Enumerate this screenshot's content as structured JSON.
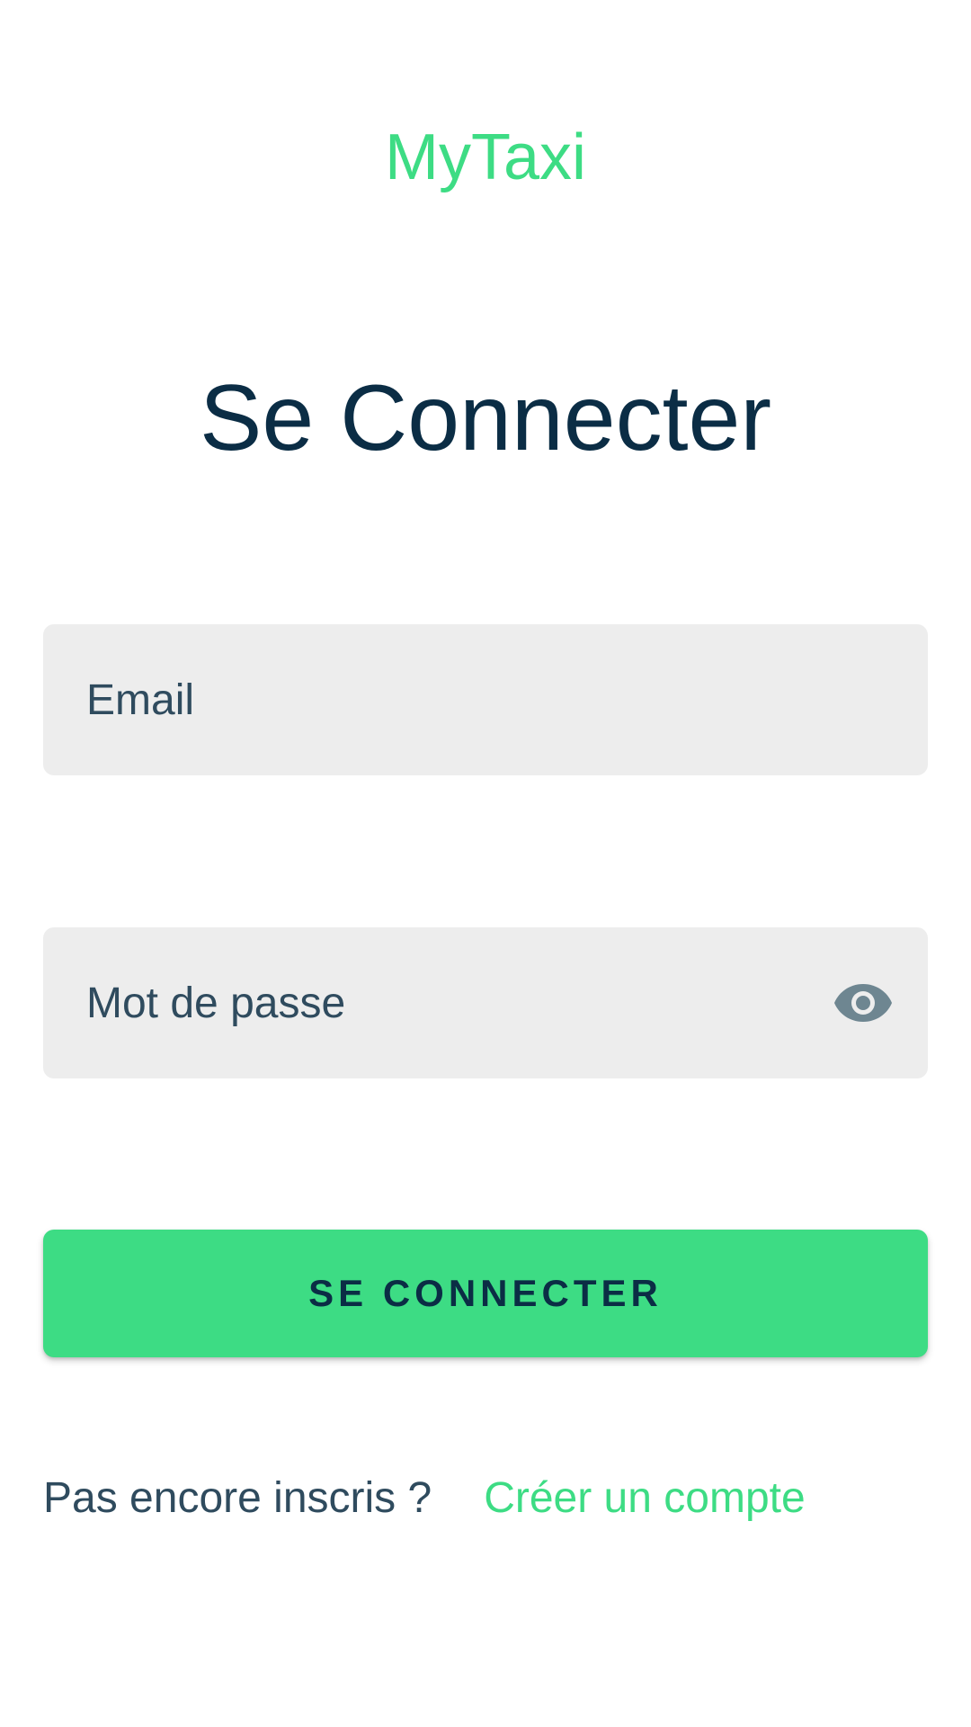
{
  "app": {
    "brand": "MyTaxi"
  },
  "login": {
    "title": "Se Connecter",
    "email": {
      "value": "",
      "placeholder": "Email"
    },
    "password": {
      "value": "",
      "placeholder": "Mot de passe",
      "toggle_icon": "eye-icon"
    },
    "submit_label": "SE CONNECTER"
  },
  "signup": {
    "question": "Pas encore inscris ?",
    "link_label": "Créer un compte"
  },
  "colors": {
    "accent": "#3ddc84",
    "title_text": "#0b2d45",
    "body_text": "#2f4b5e",
    "field_background": "#ededed",
    "icon": "#6e8691"
  }
}
